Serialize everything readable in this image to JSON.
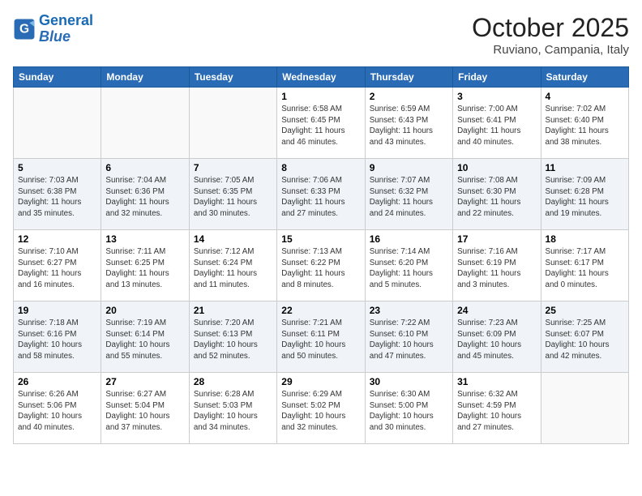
{
  "header": {
    "logo_line1": "General",
    "logo_line2": "Blue",
    "month": "October 2025",
    "location": "Ruviano, Campania, Italy"
  },
  "days_of_week": [
    "Sunday",
    "Monday",
    "Tuesday",
    "Wednesday",
    "Thursday",
    "Friday",
    "Saturday"
  ],
  "weeks": [
    [
      {
        "num": "",
        "info": ""
      },
      {
        "num": "",
        "info": ""
      },
      {
        "num": "",
        "info": ""
      },
      {
        "num": "1",
        "info": "Sunrise: 6:58 AM\nSunset: 6:45 PM\nDaylight: 11 hours\nand 46 minutes."
      },
      {
        "num": "2",
        "info": "Sunrise: 6:59 AM\nSunset: 6:43 PM\nDaylight: 11 hours\nand 43 minutes."
      },
      {
        "num": "3",
        "info": "Sunrise: 7:00 AM\nSunset: 6:41 PM\nDaylight: 11 hours\nand 40 minutes."
      },
      {
        "num": "4",
        "info": "Sunrise: 7:02 AM\nSunset: 6:40 PM\nDaylight: 11 hours\nand 38 minutes."
      }
    ],
    [
      {
        "num": "5",
        "info": "Sunrise: 7:03 AM\nSunset: 6:38 PM\nDaylight: 11 hours\nand 35 minutes."
      },
      {
        "num": "6",
        "info": "Sunrise: 7:04 AM\nSunset: 6:36 PM\nDaylight: 11 hours\nand 32 minutes."
      },
      {
        "num": "7",
        "info": "Sunrise: 7:05 AM\nSunset: 6:35 PM\nDaylight: 11 hours\nand 30 minutes."
      },
      {
        "num": "8",
        "info": "Sunrise: 7:06 AM\nSunset: 6:33 PM\nDaylight: 11 hours\nand 27 minutes."
      },
      {
        "num": "9",
        "info": "Sunrise: 7:07 AM\nSunset: 6:32 PM\nDaylight: 11 hours\nand 24 minutes."
      },
      {
        "num": "10",
        "info": "Sunrise: 7:08 AM\nSunset: 6:30 PM\nDaylight: 11 hours\nand 22 minutes."
      },
      {
        "num": "11",
        "info": "Sunrise: 7:09 AM\nSunset: 6:28 PM\nDaylight: 11 hours\nand 19 minutes."
      }
    ],
    [
      {
        "num": "12",
        "info": "Sunrise: 7:10 AM\nSunset: 6:27 PM\nDaylight: 11 hours\nand 16 minutes."
      },
      {
        "num": "13",
        "info": "Sunrise: 7:11 AM\nSunset: 6:25 PM\nDaylight: 11 hours\nand 13 minutes."
      },
      {
        "num": "14",
        "info": "Sunrise: 7:12 AM\nSunset: 6:24 PM\nDaylight: 11 hours\nand 11 minutes."
      },
      {
        "num": "15",
        "info": "Sunrise: 7:13 AM\nSunset: 6:22 PM\nDaylight: 11 hours\nand 8 minutes."
      },
      {
        "num": "16",
        "info": "Sunrise: 7:14 AM\nSunset: 6:20 PM\nDaylight: 11 hours\nand 5 minutes."
      },
      {
        "num": "17",
        "info": "Sunrise: 7:16 AM\nSunset: 6:19 PM\nDaylight: 11 hours\nand 3 minutes."
      },
      {
        "num": "18",
        "info": "Sunrise: 7:17 AM\nSunset: 6:17 PM\nDaylight: 11 hours\nand 0 minutes."
      }
    ],
    [
      {
        "num": "19",
        "info": "Sunrise: 7:18 AM\nSunset: 6:16 PM\nDaylight: 10 hours\nand 58 minutes."
      },
      {
        "num": "20",
        "info": "Sunrise: 7:19 AM\nSunset: 6:14 PM\nDaylight: 10 hours\nand 55 minutes."
      },
      {
        "num": "21",
        "info": "Sunrise: 7:20 AM\nSunset: 6:13 PM\nDaylight: 10 hours\nand 52 minutes."
      },
      {
        "num": "22",
        "info": "Sunrise: 7:21 AM\nSunset: 6:11 PM\nDaylight: 10 hours\nand 50 minutes."
      },
      {
        "num": "23",
        "info": "Sunrise: 7:22 AM\nSunset: 6:10 PM\nDaylight: 10 hours\nand 47 minutes."
      },
      {
        "num": "24",
        "info": "Sunrise: 7:23 AM\nSunset: 6:09 PM\nDaylight: 10 hours\nand 45 minutes."
      },
      {
        "num": "25",
        "info": "Sunrise: 7:25 AM\nSunset: 6:07 PM\nDaylight: 10 hours\nand 42 minutes."
      }
    ],
    [
      {
        "num": "26",
        "info": "Sunrise: 6:26 AM\nSunset: 5:06 PM\nDaylight: 10 hours\nand 40 minutes."
      },
      {
        "num": "27",
        "info": "Sunrise: 6:27 AM\nSunset: 5:04 PM\nDaylight: 10 hours\nand 37 minutes."
      },
      {
        "num": "28",
        "info": "Sunrise: 6:28 AM\nSunset: 5:03 PM\nDaylight: 10 hours\nand 34 minutes."
      },
      {
        "num": "29",
        "info": "Sunrise: 6:29 AM\nSunset: 5:02 PM\nDaylight: 10 hours\nand 32 minutes."
      },
      {
        "num": "30",
        "info": "Sunrise: 6:30 AM\nSunset: 5:00 PM\nDaylight: 10 hours\nand 30 minutes."
      },
      {
        "num": "31",
        "info": "Sunrise: 6:32 AM\nSunset: 4:59 PM\nDaylight: 10 hours\nand 27 minutes."
      },
      {
        "num": "",
        "info": ""
      }
    ]
  ]
}
